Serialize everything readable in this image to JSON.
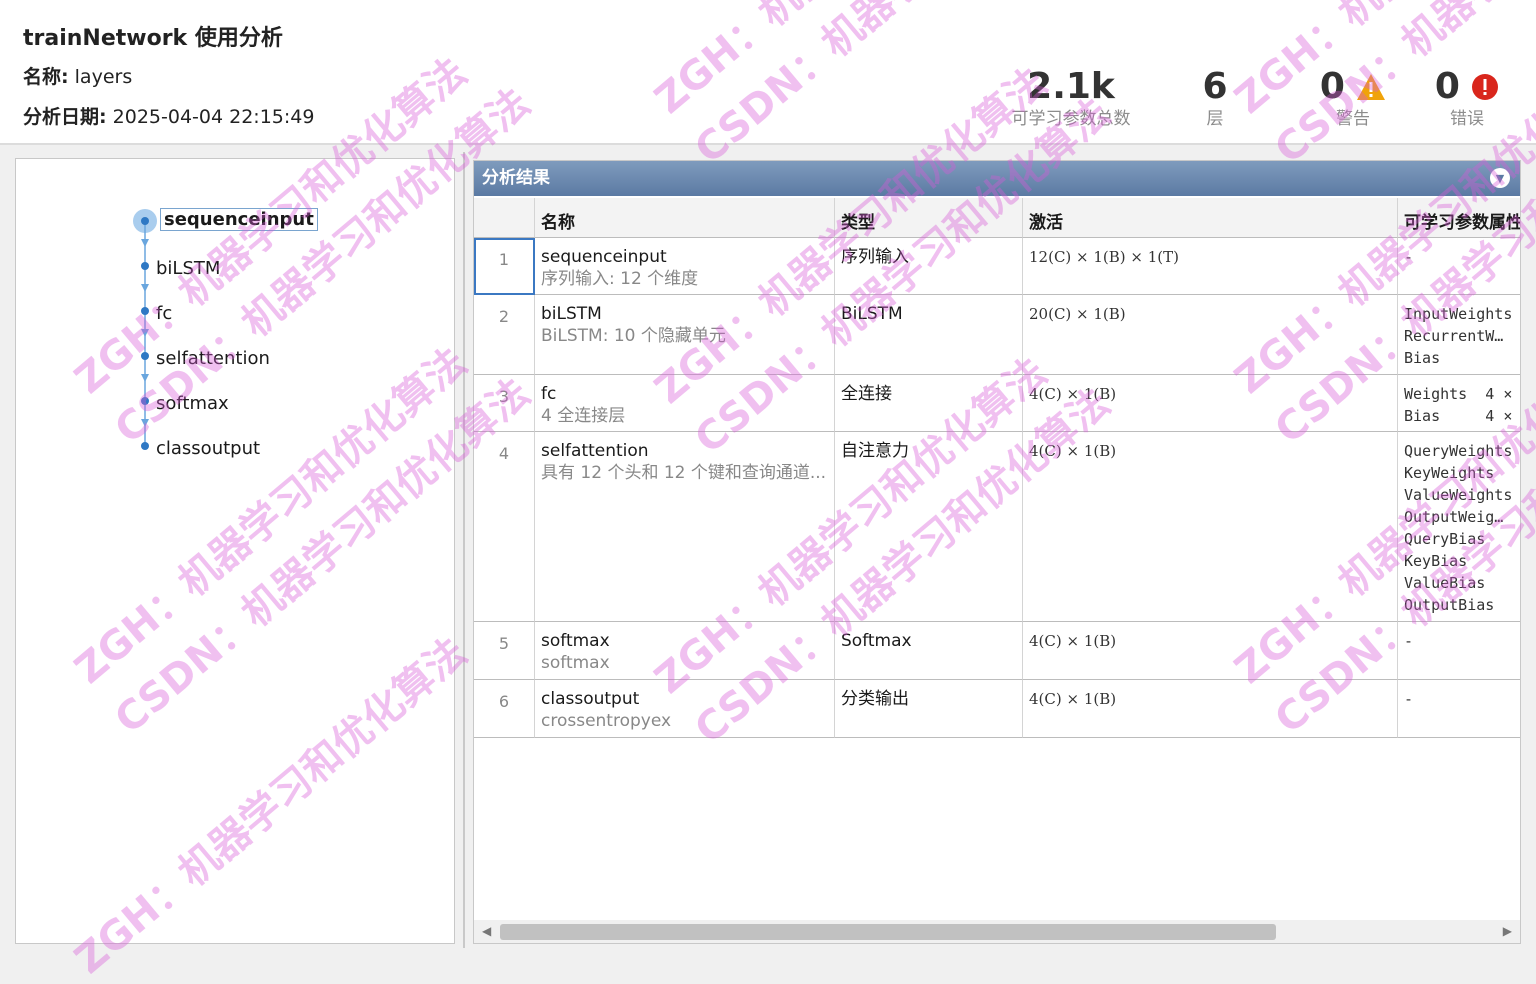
{
  "header": {
    "title": "trainNetwork 使用分析",
    "name_label": "名称:",
    "name_value": "layers",
    "date_label": "分析日期:",
    "date_value": "2025-04-04 22:15:49",
    "metrics": [
      {
        "value": "2.1k",
        "label": "可学习参数总数"
      },
      {
        "value": "6",
        "label": "层"
      },
      {
        "value": "0",
        "label": "警告",
        "icon": "warning-triangle-icon",
        "color": "#f0a30a"
      },
      {
        "value": "0",
        "label": "错误",
        "icon": "error-circle-icon",
        "color": "#d9261c"
      }
    ]
  },
  "graph": {
    "selected": "sequenceinput",
    "nodes": [
      "sequenceinput",
      "biLSTM",
      "fc",
      "selfattention",
      "softmax",
      "classoutput"
    ],
    "accent": "#2e78c4"
  },
  "results": {
    "title": "分析结果",
    "columns": [
      "",
      "名称",
      "类型",
      "激活",
      "可学习参数属性"
    ],
    "rows": [
      {
        "index": "1",
        "name": "sequenceinput",
        "desc": "序列输入: 12 个维度",
        "type": "序列输入",
        "activation": "12(C) × 1(B) × 1(T)",
        "learnables": "-"
      },
      {
        "index": "2",
        "name": "biLSTM",
        "desc": "BiLSTM: 10 个隐藏单元",
        "type": "BiLSTM",
        "activation": "20(C) × 1(B)",
        "learnables": "InputWeights\nRecurrentW…\nBias"
      },
      {
        "index": "3",
        "name": "fc",
        "desc": "4 全连接层",
        "type": "全连接",
        "activation": "4(C) × 1(B)",
        "learnables": "Weights  4 ×\nBias     4 ×"
      },
      {
        "index": "4",
        "name": "selfattention",
        "desc": "具有 12 个头和 12 个键和查询通道...",
        "type": "自注意力",
        "activation": "4(C) × 1(B)",
        "learnables": "QueryWeights\nKeyWeights\nValueWeights\nOutputWeig…\nQueryBias\nKeyBias\nValueBias\nOutputBias"
      },
      {
        "index": "5",
        "name": "softmax",
        "desc": "softmax",
        "type": "Softmax",
        "activation": "4(C) × 1(B)",
        "learnables": "-"
      },
      {
        "index": "6",
        "name": "classoutput",
        "desc": "crossentropyex",
        "type": "分类输出",
        "activation": "4(C) × 1(B)",
        "learnables": "-"
      }
    ]
  },
  "watermark": {
    "line1": "ZGH：机器学习和优化算法",
    "line2": "CSDN：机器学习和优化算法",
    "color": "#d75ad7"
  }
}
